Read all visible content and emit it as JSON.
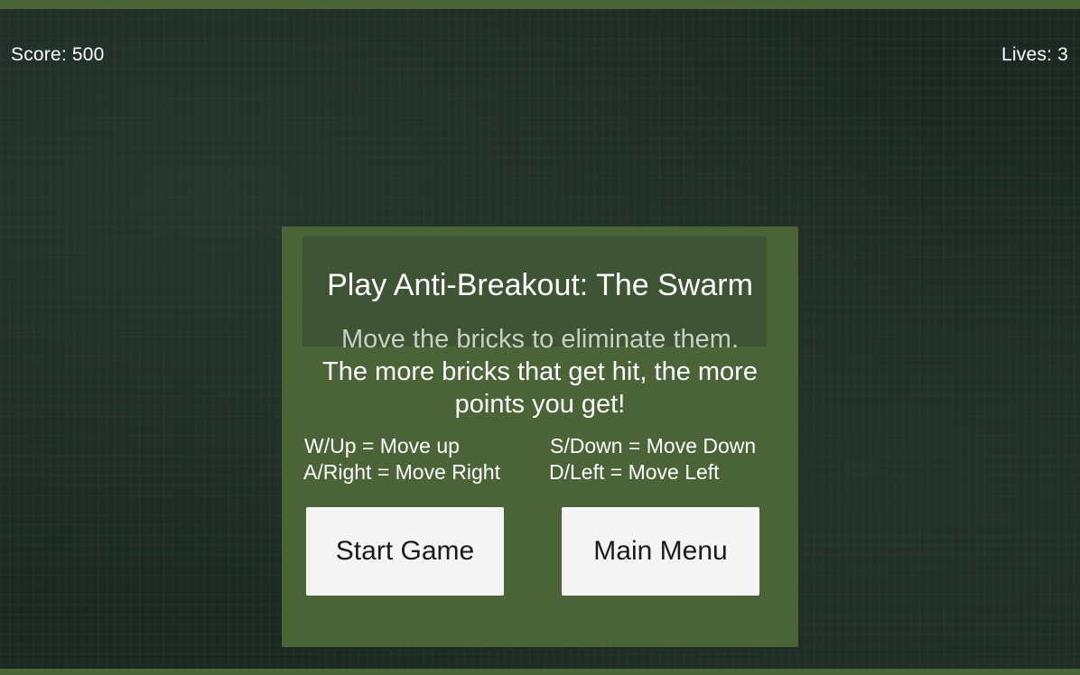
{
  "hud": {
    "score": "Score: 500",
    "lives": "Lives: 3"
  },
  "dialog": {
    "title": "Play Anti-Breakout: The Swarm",
    "description_lines": [
      "Move the bricks to eliminate them.",
      "The more bricks that get hit, the more",
      "points you get!"
    ],
    "controls": [
      "W/Up = Move up",
      "S/Down = Move Down",
      "A/Right = Move Right",
      "D/Left = Move Left"
    ],
    "buttons": {
      "start": "Start Game",
      "menu": "Main Menu"
    }
  },
  "colors": {
    "background": "#1c2a24",
    "panel": "#4a6438",
    "title_bar": "#3f5434",
    "button": "#f4f4f4"
  }
}
